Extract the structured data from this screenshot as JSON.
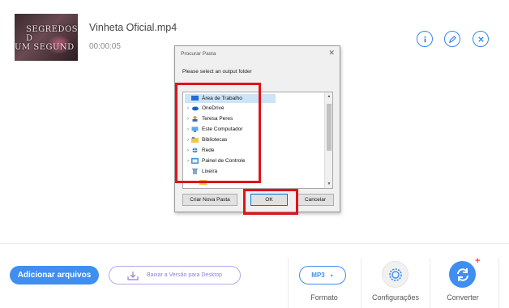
{
  "file": {
    "thumbnail_text_line1": "SEGREDOS D",
    "thumbnail_text_line2": "UM SEGUND",
    "name": "Vinheta Oficial.mp4",
    "duration": "00:00:05",
    "actions": [
      "info-icon",
      "edit-icon",
      "close-icon"
    ]
  },
  "dialog": {
    "title": "Procurar Pasta",
    "close_glyph": "✕",
    "description": "Please select an output folder",
    "tree": [
      {
        "label": "Área de Trabalho",
        "icon": "desktop-icon",
        "selected": true,
        "expandable": false
      },
      {
        "label": "OneDrive",
        "icon": "cloud-icon",
        "selected": false,
        "expandable": true
      },
      {
        "label": "Teresa Peres",
        "icon": "user-icon",
        "selected": false,
        "expandable": true
      },
      {
        "label": "Este Computador",
        "icon": "computer-icon",
        "selected": false,
        "expandable": true
      },
      {
        "label": "Bibliotecas",
        "icon": "library-icon",
        "selected": false,
        "expandable": true
      },
      {
        "label": "Rede",
        "icon": "network-icon",
        "selected": false,
        "expandable": true
      },
      {
        "label": "Painel de Controle",
        "icon": "control-panel-icon",
        "selected": false,
        "expandable": true
      },
      {
        "label": "Lixeira",
        "icon": "recycle-bin-icon",
        "selected": false,
        "expandable": false
      }
    ],
    "buttons": {
      "new_folder": "Criar Nova Pasta",
      "ok": "OK",
      "cancel": "Cancelar"
    }
  },
  "toolbar": {
    "add_files": "Adicionar arquivos",
    "download_desktop": "Baixar a Versão para Desktop",
    "format_value": "MP3",
    "format_label": "Formato",
    "settings_label": "Configurações",
    "convert_label": "Converter"
  },
  "colors": {
    "accent": "#3f8ef0",
    "highlight": "#e0131b",
    "download_outline": "#b8a8e8",
    "convert_badge": "#e8561f"
  }
}
